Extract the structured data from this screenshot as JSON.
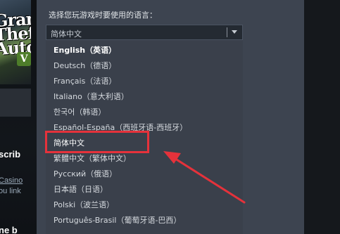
{
  "background": {
    "game_logo_text": "Grand\nTheft\nAuto",
    "game_logo_badge": "V",
    "side_texts": [
      "scrib",
      "Casino",
      "ou link",
      "ne b"
    ]
  },
  "dialog": {
    "prompt": "选择您玩游戏时要使用的语言：",
    "selected_value": "简体中文",
    "options": [
      "English（英语）",
      "Deutsch（德语）",
      "Français（法语）",
      "Italiano（意大利语）",
      "한국어（韩语）",
      "Español-España（西班牙语-西班牙）",
      "简体中文",
      "繁體中文（繁体中文）",
      "Русский（俄语）",
      "日本語（日语）",
      "Polski（波兰语）",
      "Português-Brasil（葡萄牙语-巴西）"
    ]
  },
  "annotation": {
    "highlight_color": "#e5323b",
    "arrow_color": "#e5323b"
  },
  "colors": {
    "dialog_bg": "#3d4450",
    "select_bg": "#242a32",
    "text": "#d6dadf"
  }
}
